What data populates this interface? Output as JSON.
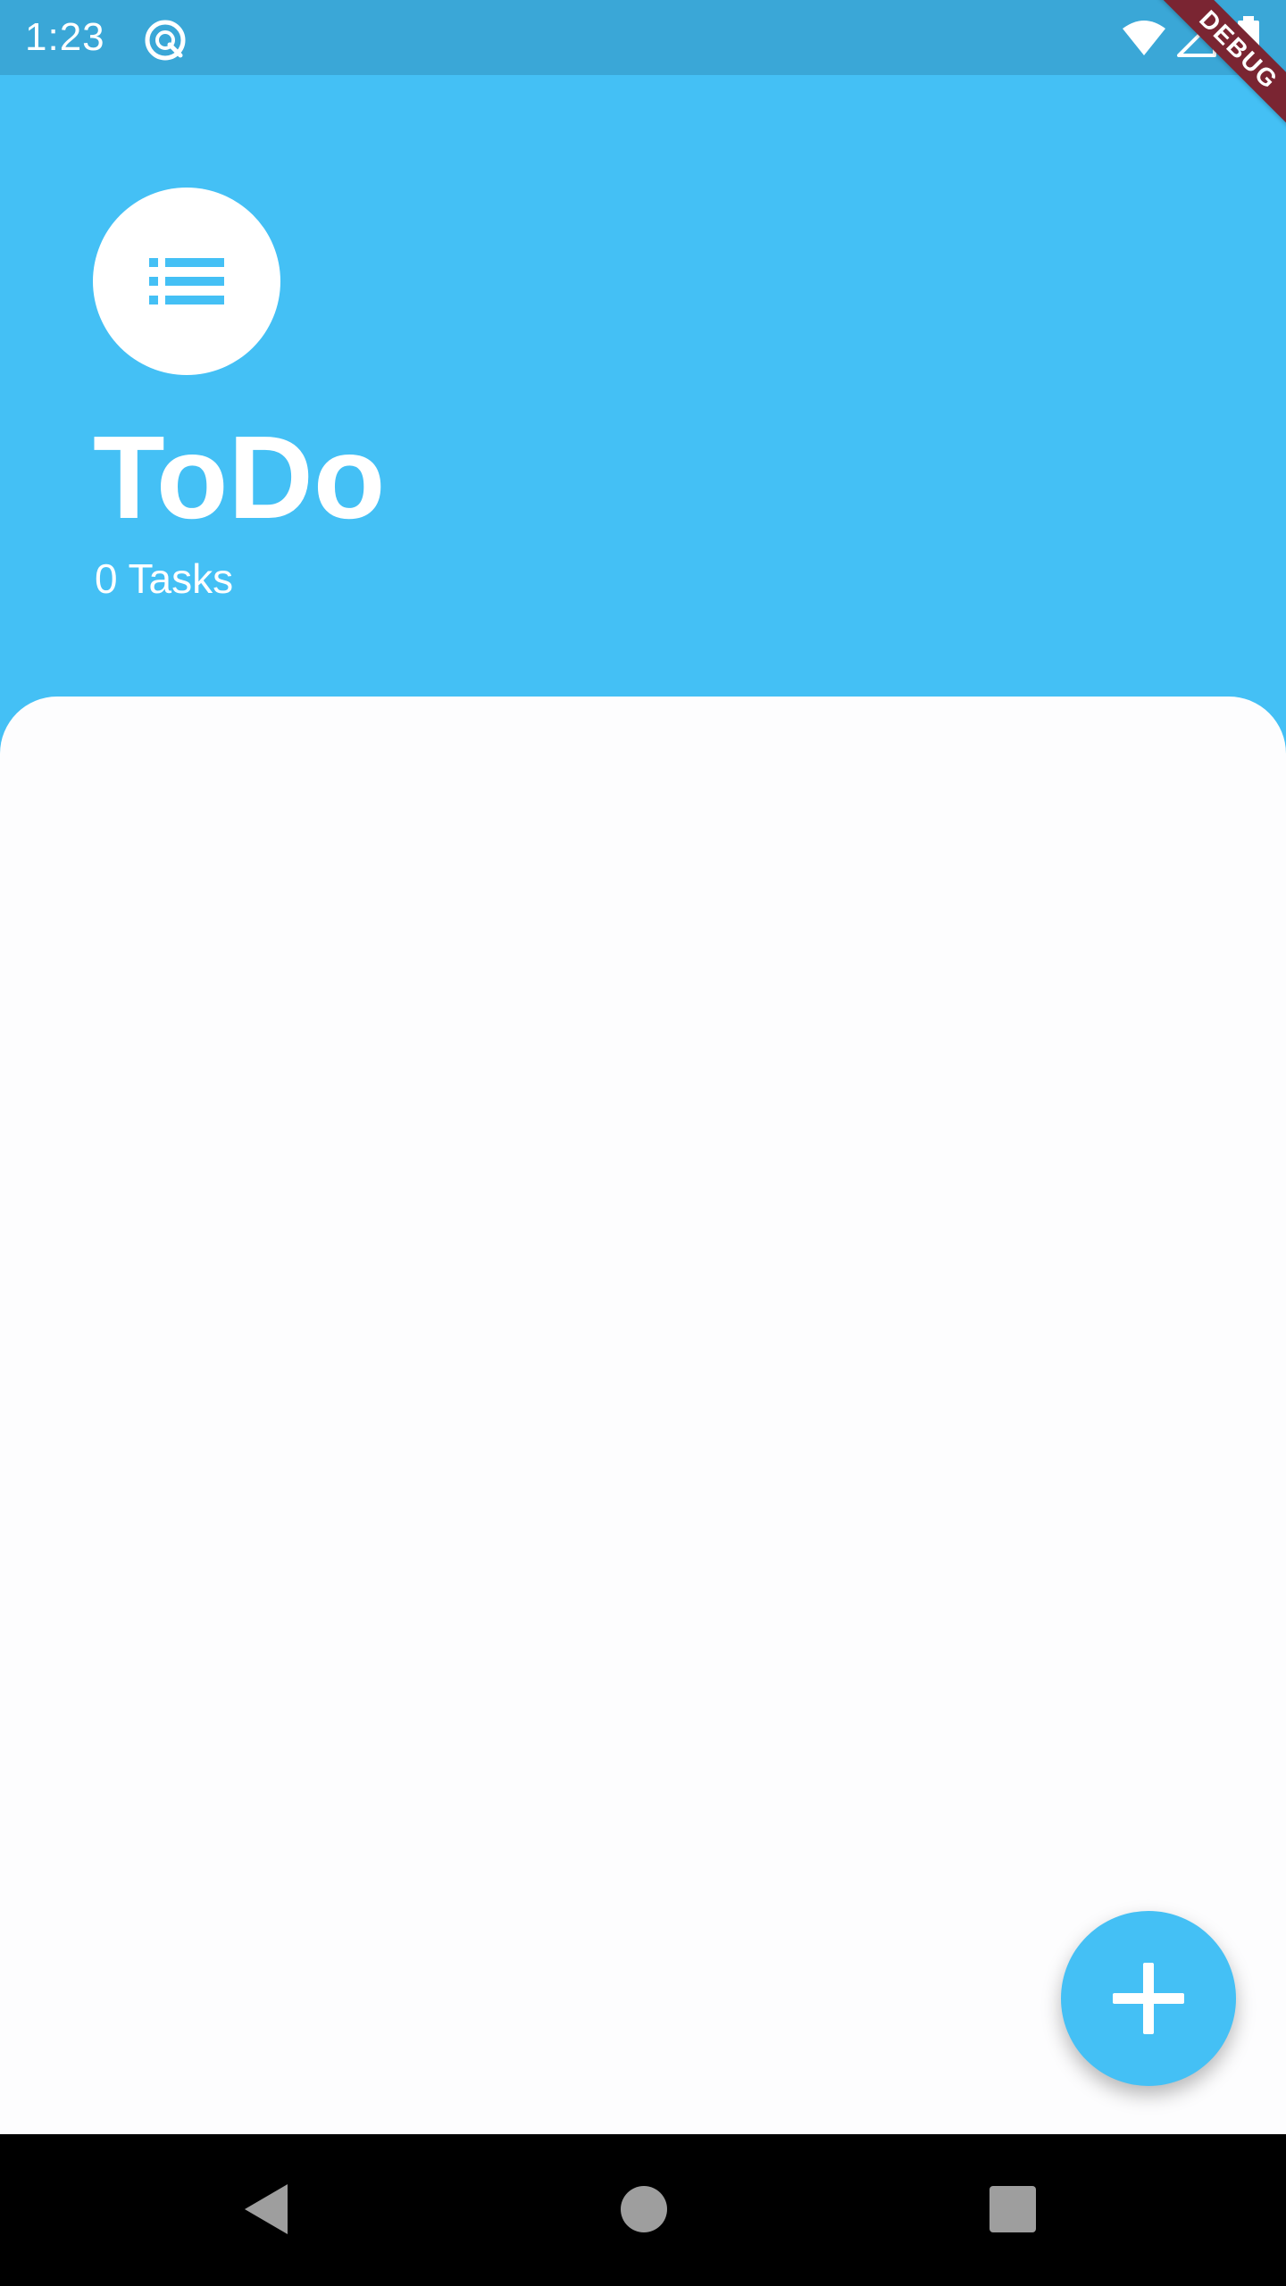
{
  "status_bar": {
    "time": "1:23",
    "icons": [
      "app-notification-icon",
      "wifi-icon",
      "signal-icon",
      "battery-icon"
    ]
  },
  "debug_banner": {
    "label": "DEBUG",
    "color": "#7a2532"
  },
  "header": {
    "icon": "list-icon",
    "title": "ToDo",
    "task_count": "0 Tasks",
    "background_color": "#44c0f5"
  },
  "fab": {
    "icon": "plus-icon",
    "color": "#44c0f5"
  },
  "nav_bar": {
    "buttons": [
      "back-icon",
      "home-icon",
      "recents-icon"
    ]
  }
}
